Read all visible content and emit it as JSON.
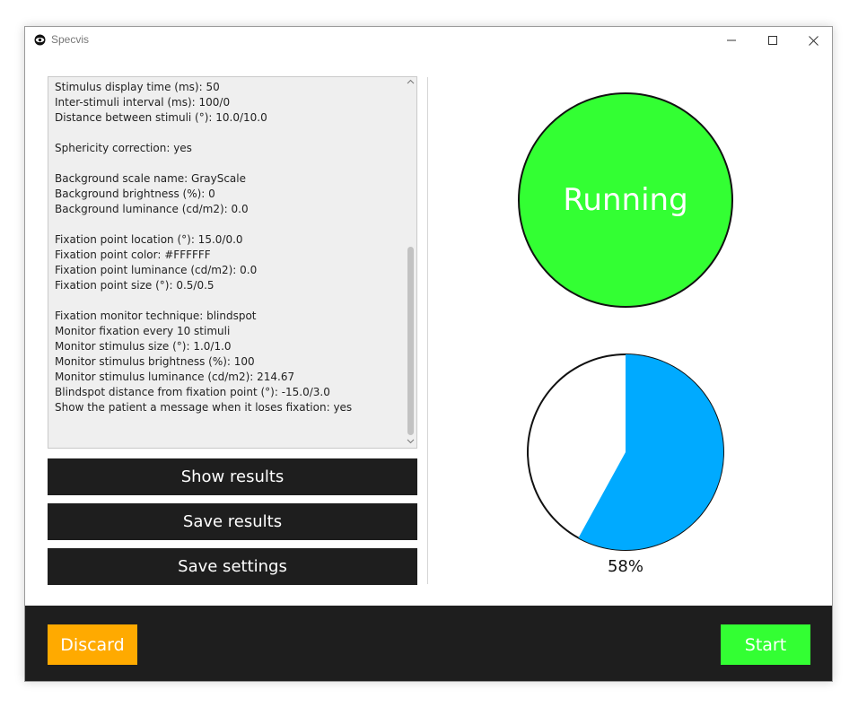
{
  "window": {
    "title": "Specvis",
    "icons": {
      "app": "eye-icon",
      "minimize": "minimize-icon",
      "maximize": "maximize-icon",
      "close": "close-icon"
    }
  },
  "log": {
    "lines": [
      "Stimulus display time (ms): 50",
      "Inter-stimuli interval (ms): 100/0",
      "Distance between stimuli (°): 10.0/10.0",
      "",
      "Sphericity correction: yes",
      "",
      "Background scale name: GrayScale",
      "Background brightness (%): 0",
      "Background luminance (cd/m2): 0.0",
      "",
      "Fixation point location (°): 15.0/0.0",
      "Fixation point color: #FFFFFF",
      "Fixation point luminance (cd/m2): 0.0",
      "Fixation point size (°): 0.5/0.5",
      "",
      "Fixation monitor technique: blindspot",
      "Monitor fixation every 10 stimuli",
      "Monitor stimulus size (°): 1.0/1.0",
      "Monitor stimulus brightness (%): 100",
      "Monitor stimulus luminance (cd/m2): 214.67",
      "Blindspot distance from fixation point (°): -15.0/3.0",
      "Show the patient a message when it loses fixation: yes"
    ]
  },
  "actions": {
    "show_results": "Show results",
    "save_results": "Save results",
    "save_settings": "Save settings"
  },
  "status": {
    "text": "Running",
    "color": "#33ff33"
  },
  "progress": {
    "fraction": 0.58,
    "label": "58%",
    "fill_color": "#00aaff"
  },
  "footer": {
    "discard_label": "Discard",
    "discard_color": "#ffaa00",
    "start_label": "Start",
    "start_color": "#33ff33"
  }
}
